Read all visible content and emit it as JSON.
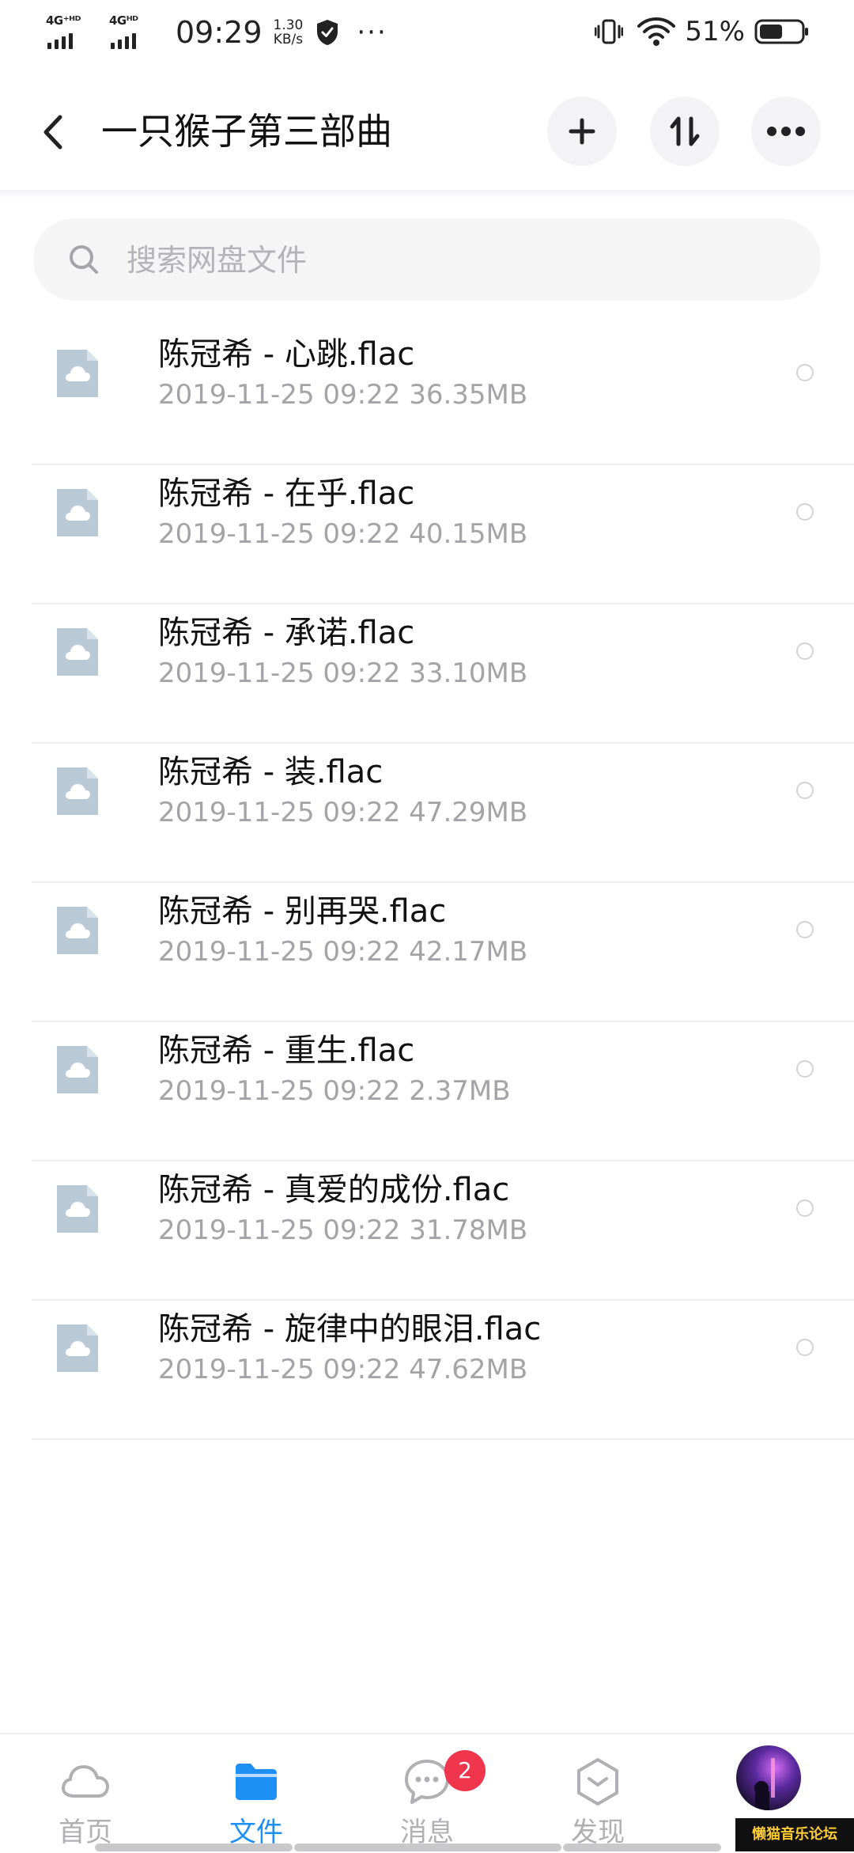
{
  "status_bar": {
    "net1": "4G⁺ᴴᴰ",
    "net2": "4Gᴴᴰ",
    "time": "09:29",
    "speed_value": "1.30",
    "speed_unit": "KB/s",
    "more": "···",
    "battery": "51%"
  },
  "header": {
    "title": "一只猴子第三部曲",
    "icons": [
      "back-icon",
      "plus-icon",
      "sort-icon",
      "more-icon"
    ]
  },
  "search": {
    "placeholder": "搜索网盘文件",
    "value": ""
  },
  "files": [
    {
      "name": "陈冠希 - 心跳.flac",
      "meta": "2019-11-25  09:22  36.35MB"
    },
    {
      "name": "陈冠希 - 在乎.flac",
      "meta": "2019-11-25  09:22  40.15MB"
    },
    {
      "name": "陈冠希 - 承诺.flac",
      "meta": "2019-11-25  09:22  33.10MB"
    },
    {
      "name": "陈冠希 - 装.flac",
      "meta": "2019-11-25  09:22  47.29MB"
    },
    {
      "name": "陈冠希 - 别再哭.flac",
      "meta": "2019-11-25  09:22  42.17MB"
    },
    {
      "name": "陈冠希 - 重生.flac",
      "meta": "2019-11-25  09:22  2.37MB"
    },
    {
      "name": "陈冠希 - 真爱的成份.flac",
      "meta": "2019-11-25  09:22  31.78MB"
    },
    {
      "name": "陈冠希 - 旋律中的眼泪.flac",
      "meta": "2019-11-25  09:22  47.62MB"
    }
  ],
  "tabs": [
    {
      "label": "首页",
      "icon": "cloud-icon",
      "active": false
    },
    {
      "label": "文件",
      "icon": "folder-icon",
      "active": true
    },
    {
      "label": "消息",
      "icon": "chat-icon",
      "active": false,
      "badge": "2"
    },
    {
      "label": "发现",
      "icon": "discover-icon",
      "active": false
    }
  ],
  "watermark": "懒猫音乐论坛",
  "colors": {
    "accent": "#1e8ff5",
    "badge": "#f0364d",
    "file_icon": "#b9c9d6",
    "meta_text": "#a3a3a8"
  }
}
